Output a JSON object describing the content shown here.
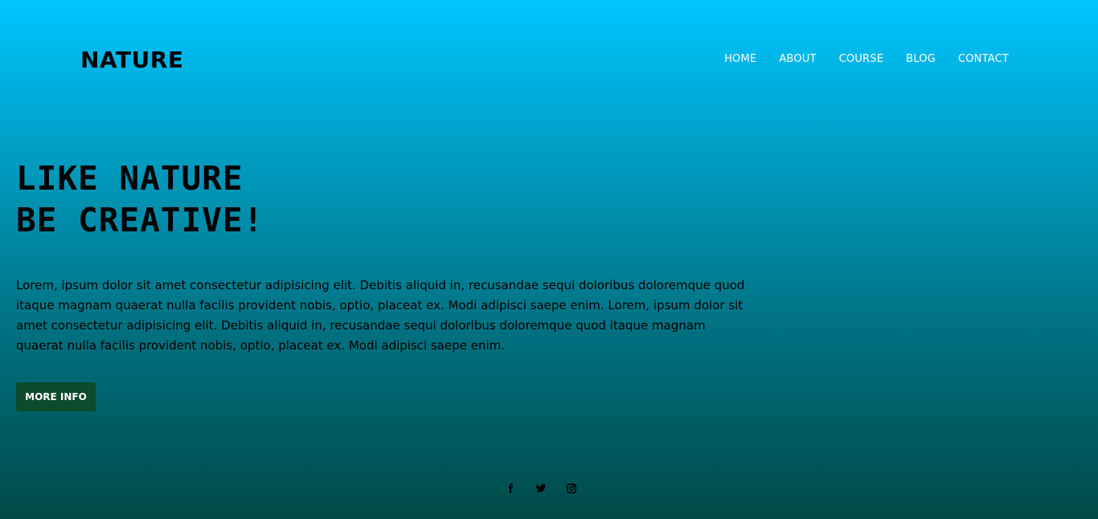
{
  "brand": {
    "logo_text": "NATURE"
  },
  "nav": {
    "items": [
      {
        "label": "HOME"
      },
      {
        "label": "ABOUT"
      },
      {
        "label": "COURSE"
      },
      {
        "label": "BLOG"
      },
      {
        "label": "CONTACT"
      }
    ]
  },
  "hero": {
    "title_line1": "LIKE NATURE",
    "title_line2": "BE CREATIVE!",
    "paragraph": "Lorem, ipsum dolor sit amet consectetur adipisicing elit. Debitis aliquid in, recusandae sequi doloribus doloremque quod itaque magnam quaerat nulla facilis provident nobis, optio, placeat ex. Modi adipisci saepe enim. Lorem, ipsum dolor sit amet consectetur adipisicing elit. Debitis aliquid in, recusandae sequi doloribus doloremque quod itaque magnam quaerat nulla facilis provident nobis, optio, placeat ex. Modi adipisci saepe enim.",
    "button_label": "MORE INFO"
  },
  "socials": {
    "icons": [
      "facebook-icon",
      "twitter-icon",
      "instagram-icon"
    ]
  },
  "colors": {
    "gradient_top": "#00c6ff",
    "gradient_bottom": "#004a48",
    "button_bg": "#0b4a2a"
  }
}
